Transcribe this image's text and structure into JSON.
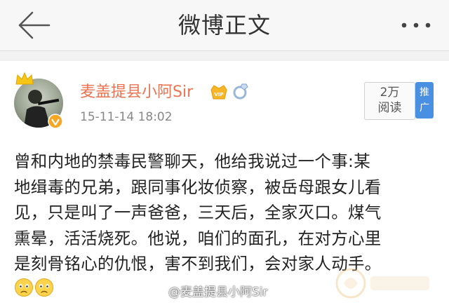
{
  "header": {
    "title": "微博正文",
    "back_icon": "arrow-left-icon",
    "more_icon": "more-dots-icon"
  },
  "post": {
    "author": "麦盖提县小阿Sir",
    "timestamp": "15-11-14 18:02",
    "read_count": "2万",
    "read_label": "阅读",
    "promote_chars": [
      "推",
      "广"
    ],
    "lines": [
      "曾和内地的禁毒民警聊天，他给我说过一个事:某",
      "地缉毒的兄弟，跟同事化妆侦察，被岳母跟女儿看",
      "见，只是叫了一声爸爸，三天后，全家灭口。煤气",
      "熏晕，活活烧死。他说，咱们的面孔，在对方心里",
      "是刻骨铭心的仇恨，害不到我们，会对家人动手。"
    ],
    "emojis": [
      "sad-face-icon",
      "sad-face-icon"
    ]
  },
  "watermark": "@麦盖提县小阿Sir",
  "colors": {
    "username": "#eb7350",
    "promote": "#4a90e2",
    "verified": "#f5a623"
  }
}
